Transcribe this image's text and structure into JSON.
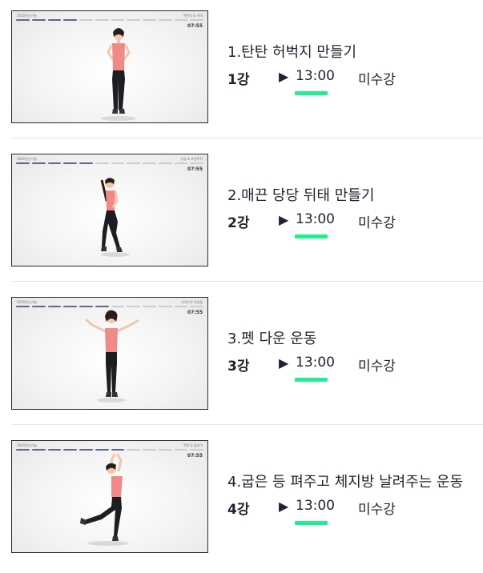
{
  "lectures": [
    {
      "title": "1.탄탄 허벅지 만들기",
      "session": "1강",
      "play_icon": "▶",
      "duration": "13:00",
      "status": "미수강",
      "thumb_brand": "2020전신기술",
      "thumb_caption": "백런지 & 사이",
      "thumb_timer": "07:55"
    },
    {
      "title": "2.매끈 당당 뒤태 만들기",
      "session": "2강",
      "play_icon": "▶",
      "duration": "13:00",
      "status": "미수강",
      "thumb_brand": "2020전신기술",
      "thumb_caption": "사업 & 프론트킥",
      "thumb_timer": "07:55"
    },
    {
      "title": "3.펫 다운 운동",
      "session": "3강",
      "play_icon": "▶",
      "duration": "13:00",
      "status": "미수강",
      "thumb_brand": "2020전신기술",
      "thumb_caption": "사이드런 하업동",
      "thumb_timer": "07:55"
    },
    {
      "title": "4.굽은 등 펴주고 체지방 날려주는 운동",
      "session": "4강",
      "play_icon": "▶",
      "duration": "13:00",
      "status": "미수강",
      "thumb_brand": "2020전신기술",
      "thumb_caption": "백킥 & 플라이",
      "thumb_timer": "07:55"
    }
  ],
  "colors": {
    "accent": "#1ef08f",
    "text": "#1f2230",
    "divider": "#e6e6e6"
  }
}
